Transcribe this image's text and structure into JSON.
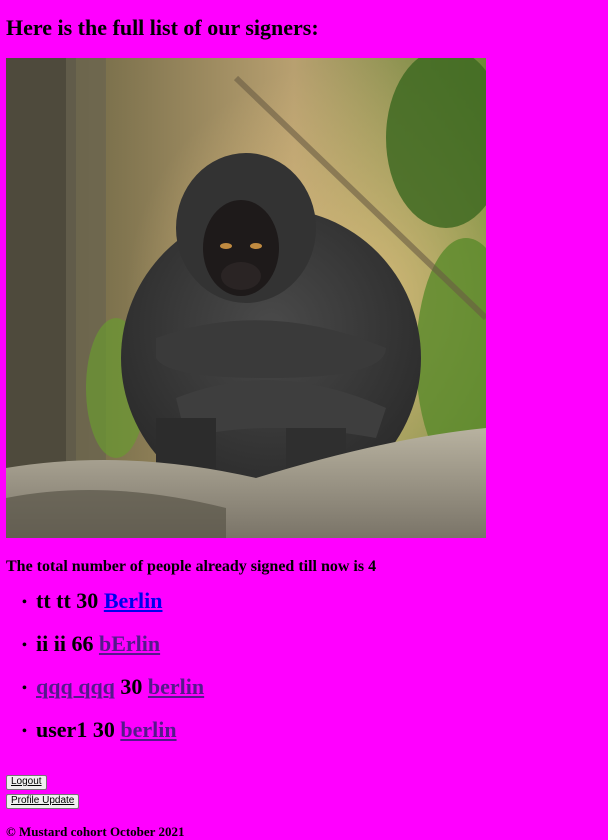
{
  "heading": "Here is the full list of our signers:",
  "photo": {
    "alt": "chimpanzee-photo"
  },
  "total_text": "The total number of people already signed till now is 4",
  "signers": [
    {
      "prefix": "tt tt 30 ",
      "name_link": "",
      "age": "",
      "city": "Berlin",
      "city_visited": false
    },
    {
      "prefix": "ii ii 66 ",
      "name_link": "",
      "age": "",
      "city": "bErlin",
      "city_visited": true
    },
    {
      "prefix": "",
      "name_link": "qqq qqq",
      "age": " 30 ",
      "city": "berlin",
      "city_visited": true
    },
    {
      "prefix": "user1 30 ",
      "name_link": "",
      "age": "",
      "city": "berlin",
      "city_visited": true
    }
  ],
  "buttons": {
    "logout": "Logout",
    "profile_update": "Profile Update"
  },
  "footer": "© Mustard cohort October 2021",
  "colors": {
    "background": "#ff00ff",
    "link": "#0000ee",
    "visited_link": "#551a8b"
  }
}
